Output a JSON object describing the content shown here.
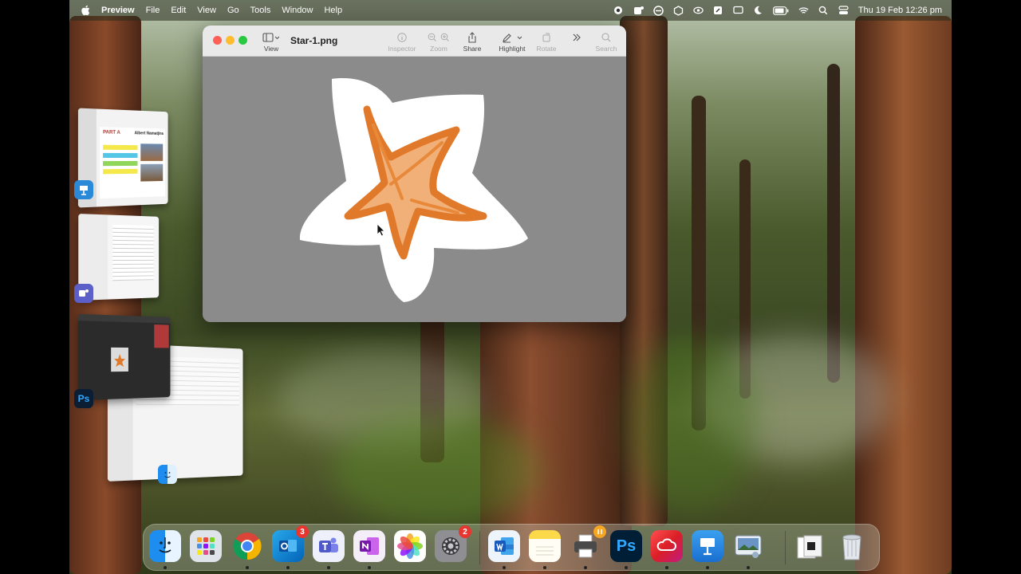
{
  "menubar": {
    "app_name": "Preview",
    "menus": [
      "File",
      "Edit",
      "View",
      "Go",
      "Tools",
      "Window",
      "Help"
    ],
    "clock": "Thu 19 Feb  12:26 pm"
  },
  "preview_window": {
    "title": "Star-1.png",
    "toolbar": {
      "view": "View",
      "inspector": "Inspector",
      "zoom": "Zoom",
      "share": "Share",
      "highlight": "Highlight",
      "rotate": "Rotate",
      "search": "Search"
    }
  },
  "stage_manager": {
    "thumb_doc_heading": "PART A",
    "thumb_doc_name": "Albert Namatjira",
    "ps_label": "Ps"
  },
  "dock": {
    "outlook_badge": "3",
    "settings_badge": "2",
    "ps_label": "Ps"
  },
  "colors": {
    "star_orange": "#e07a2a",
    "close": "#fe5f57",
    "minimize": "#febc2e",
    "zoom": "#28c840"
  }
}
